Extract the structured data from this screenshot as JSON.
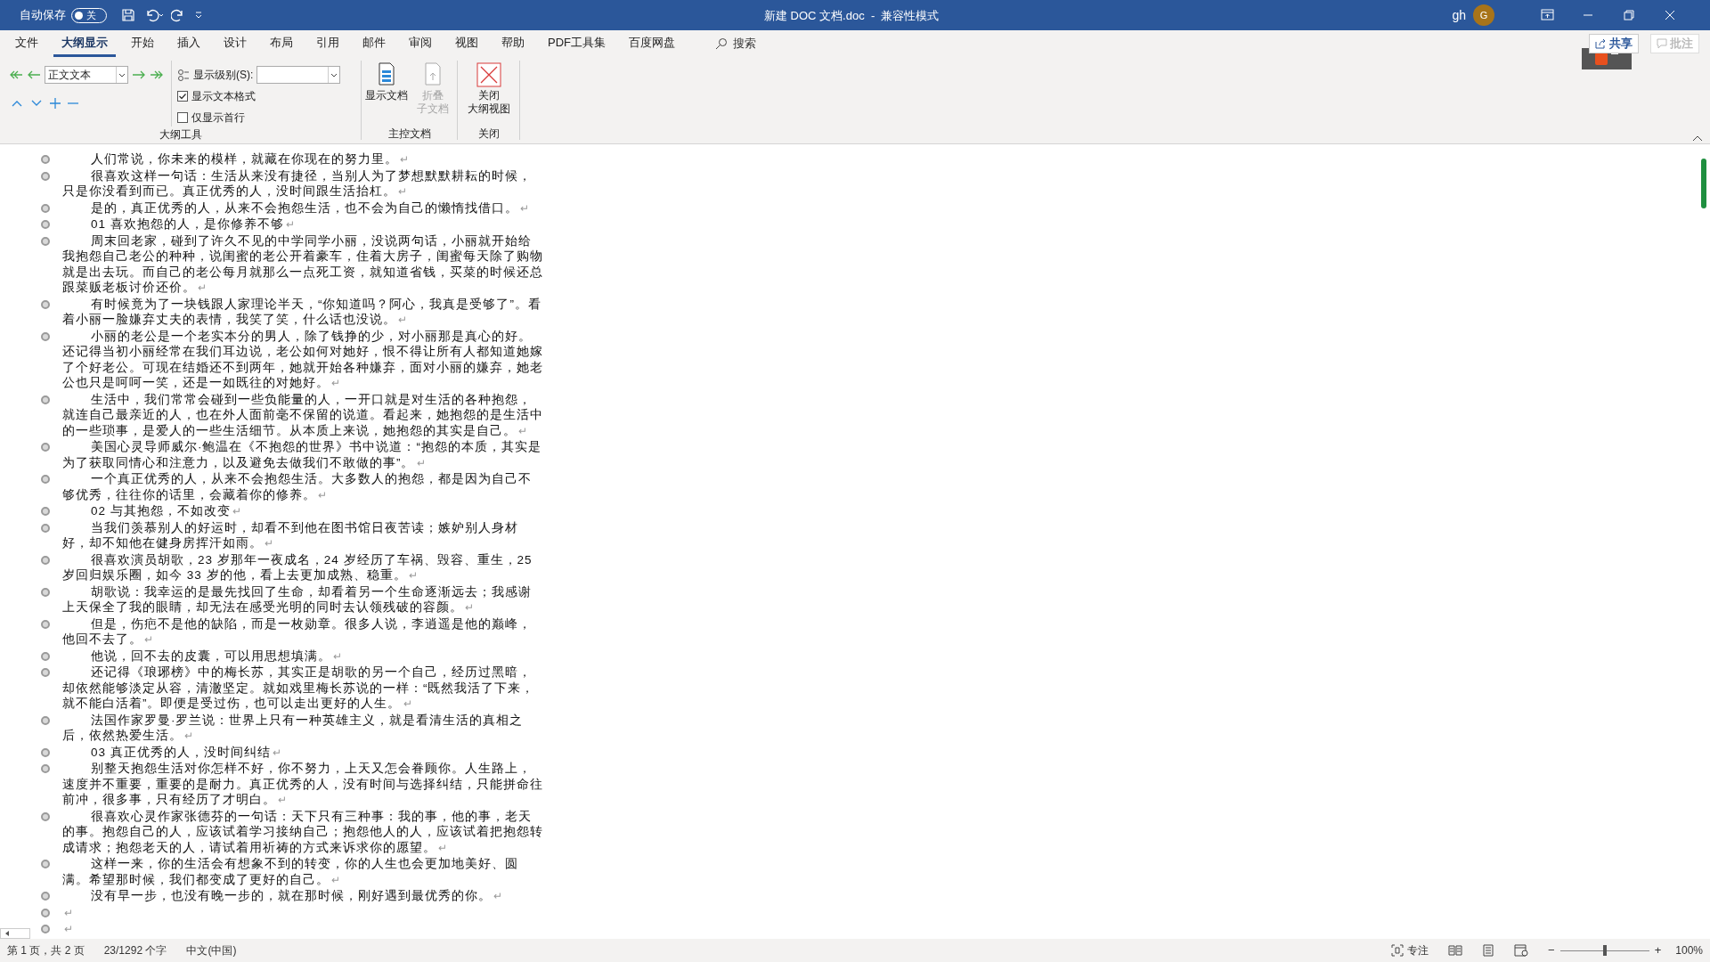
{
  "title_bar": {
    "autosave_label": "自动保存",
    "autosave_on": false,
    "autosave_state": "关",
    "title": "新建 DOC 文档.doc  -  兼容性模式",
    "user": "gh",
    "avatar": "G"
  },
  "tabs": [
    {
      "label": "文件",
      "selected": false
    },
    {
      "label": "大纲显示",
      "selected": true
    },
    {
      "label": "开始",
      "selected": false
    },
    {
      "label": "插入",
      "selected": false
    },
    {
      "label": "设计",
      "selected": false
    },
    {
      "label": "布局",
      "selected": false
    },
    {
      "label": "引用",
      "selected": false
    },
    {
      "label": "邮件",
      "selected": false
    },
    {
      "label": "审阅",
      "selected": false
    },
    {
      "label": "视图",
      "selected": false
    },
    {
      "label": "帮助",
      "selected": false
    },
    {
      "label": "PDF工具集",
      "selected": false
    },
    {
      "label": "百度网盘",
      "selected": false
    }
  ],
  "search": {
    "placeholder": "搜索"
  },
  "share_button": "共享",
  "comments_button": {
    "label": "批注",
    "disabled": true
  },
  "ribbon": {
    "outline_tools": {
      "level_value": "正文文本",
      "show_level_label": "显示级别(S):",
      "checkboxes": [
        {
          "label": "显示文本格式",
          "checked": true
        },
        {
          "label": "仅显示首行",
          "checked": false
        }
      ],
      "group_label": "大纲工具"
    },
    "master_document": {
      "buttons": [
        {
          "lines": [
            "显示文档"
          ],
          "disabled": false
        },
        {
          "lines": [
            "折叠",
            "子文档"
          ],
          "disabled": true
        }
      ],
      "group_label": "主控文档"
    },
    "close": {
      "button_lines": [
        "关闭",
        "大纲视图"
      ],
      "group_label": "关闭"
    }
  },
  "paragraphs": [
    {
      "text": "人们常说，你未来的模样，就藏在你现在的努力里。",
      "mark": "↵"
    },
    {
      "text": "很喜欢这样一句话：生活从来没有捷径，当别人为了梦想默默耕耘的时候，只是你没看到而已。真正优秀的人，没时间跟生活抬杠。",
      "mark": "↵"
    },
    {
      "text": "是的，真正优秀的人，从来不会抱怨生活，也不会为自己的懒惰找借口。",
      "mark": "↵"
    },
    {
      "text": "01 喜欢抱怨的人，是你修养不够",
      "mark": "↵"
    },
    {
      "text": "周末回老家，碰到了许久不见的中学同学小丽，没说两句话，小丽就开始给我抱怨自己老公的种种，说闺蜜的老公开着豪车，住着大房子，闺蜜每天除了购物就是出去玩。而自己的老公每月就那么一点死工资，就知道省钱，买菜的时候还总跟菜贩老板讨价还价。",
      "mark": "↵"
    },
    {
      "text": "有时候竟为了一块钱跟人家理论半天，“你知道吗？阿心，我真是受够了”。看着小丽一脸嫌弃丈夫的表情，我笑了笑，什么话也没说。",
      "mark": "↵"
    },
    {
      "text": "小丽的老公是一个老实本分的男人，除了钱挣的少，对小丽那是真心的好。还记得当初小丽经常在我们耳边说，老公如何对她好，恨不得让所有人都知道她嫁了个好老公。可现在结婚还不到两年，她就开始各种嫌弃，面对小丽的嫌弃，她老公也只是呵呵一笑，还是一如既往的对她好。",
      "mark": "↵"
    },
    {
      "text": "生活中，我们常常会碰到一些负能量的人，一开口就是对生活的各种抱怨，就连自己最亲近的人，也在外人面前毫不保留的说道。看起来，她抱怨的是生活中的一些琐事，是爱人的一些生活细节。从本质上来说，她抱怨的其实是自己。",
      "mark": "↵"
    },
    {
      "text": "美国心灵导师威尔·鲍温在《不抱怨的世界》书中说道：“抱怨的本质，其实是为了获取同情心和注意力，以及避免去做我们不敢做的事”。",
      "mark": "↵"
    },
    {
      "text": "一个真正优秀的人，从来不会抱怨生活。大多数人的抱怨，都是因为自己不够优秀，往往你的话里，会藏着你的修养。",
      "mark": "↵"
    },
    {
      "text": "02 与其抱怨，不如改变",
      "mark": "↵"
    },
    {
      "text": "当我们羡慕别人的好运时，却看不到他在图书馆日夜苦读；嫉妒别人身材好，却不知他在健身房挥汗如雨。",
      "mark": "↵"
    },
    {
      "text": "很喜欢演员胡歌，23 岁那年一夜成名，24 岁经历了车祸、毁容、重生，25 岁回归娱乐圈，如今 33 岁的他，看上去更加成熟、稳重。",
      "mark": "↵"
    },
    {
      "text": "胡歌说：我幸运的是最先找回了生命，却看着另一个生命逐渐远去；我感谢上天保全了我的眼睛，却无法在感受光明的同时去认领残破的容颜。",
      "mark": "↵"
    },
    {
      "text": "但是，伤疤不是他的缺陷，而是一枚勋章。很多人说，李逍遥是他的巅峰，他回不去了。",
      "mark": "↵"
    },
    {
      "text": "他说，回不去的皮囊，可以用思想填满。",
      "mark": "↵"
    },
    {
      "text": "还记得《琅琊榜》中的梅长苏，其实正是胡歌的另一个自己，经历过黑暗，却依然能够淡定从容，清澈坚定。就如戏里梅长苏说的一样：“既然我活了下来，就不能白活着”。即便是受过伤，也可以走出更好的人生。",
      "mark": "↵"
    },
    {
      "text": "法国作家罗曼·罗兰说：世界上只有一种英雄主义，就是看清生活的真相之后，依然热爱生活。",
      "mark": "↵"
    },
    {
      "text": "03 真正优秀的人，没时间纠结",
      "mark": "↵"
    },
    {
      "text": "别整天抱怨生活对你怎样不好，你不努力，上天又怎会眷顾你。人生路上，速度并不重要，重要的是耐力。真正优秀的人，没有时间与选择纠结，只能拼命往前冲，很多事，只有经历了才明白。",
      "mark": "↵"
    },
    {
      "text": "很喜欢心灵作家张德芬的一句话：天下只有三种事：我的事，他的事，老天的事。抱怨自己的人，应该试着学习接纳自己；抱怨他人的人，应该试着把抱怨转成请求；抱怨老天的人，请试着用祈祷的方式来诉求你的愿望。",
      "mark": "↵"
    },
    {
      "text": "这样一来，你的生活会有想象不到的转变，你的人生也会更加地美好、圆满。希望那时候，我们都变成了更好的自己。",
      "mark": "↵"
    },
    {
      "text": "没有早一步，也没有晚一步的，就在那时候，刚好遇到最优秀的你。",
      "mark": "↵"
    },
    {
      "mark": "↵"
    },
    {
      "mark": "↵"
    }
  ],
  "status_bar": {
    "page": "第 1 页，共 2 页",
    "words": "23/1292 个字",
    "language": "中文(中国)",
    "focus": "专注",
    "zoom_minus": "−",
    "zoom_plus": "+",
    "zoom_slider": {
      "level": 0.5
    },
    "zoom": "100%"
  }
}
